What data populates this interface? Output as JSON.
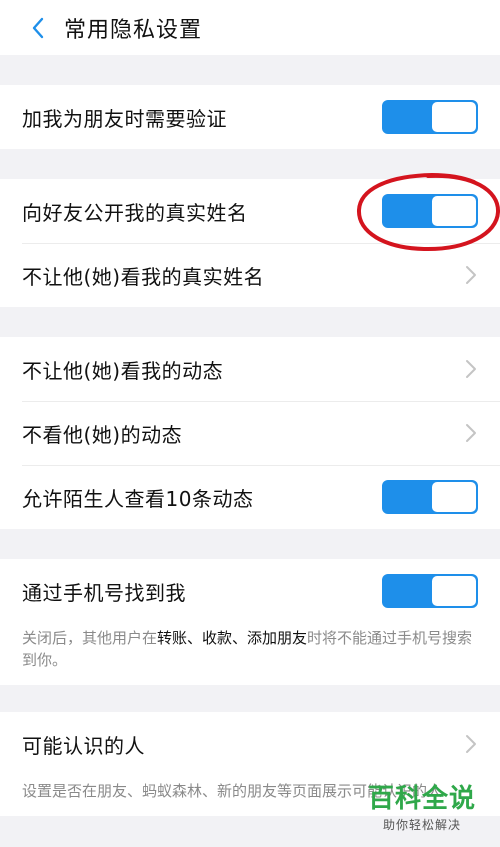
{
  "header": {
    "title": "常用隐私设置"
  },
  "groups": {
    "g1": {
      "verify_label": "加我为朋友时需要验证"
    },
    "g2": {
      "public_name_label": "向好友公开我的真实姓名",
      "hide_name_label": "不让他(她)看我的真实姓名"
    },
    "g3": {
      "hide_feed_label": "不让他(她)看我的动态",
      "not_view_label": "不看他(她)的动态",
      "stranger_label": "允许陌生人查看10条动态"
    },
    "g4": {
      "phone_label": "通过手机号找到我",
      "note_pre": "关闭后，其他用户在",
      "note_hl": "转账、收款、添加朋友",
      "note_post": "时将不能通过手机号搜索到你。"
    },
    "g5": {
      "may_know_label": "可能认识的人",
      "note": "设置是否在朋友、蚂蚁森林、新的朋友等页面展示可能认识的人"
    }
  },
  "toggles": {
    "verify": "on",
    "public_name": "on",
    "stranger": "on",
    "phone": "on"
  },
  "watermark": {
    "main": "百科全说",
    "sub": "助你轻松解决"
  },
  "colors": {
    "accent": "#1e8fea",
    "annotation": "#d4141e",
    "watermark": "#2fa84a"
  }
}
